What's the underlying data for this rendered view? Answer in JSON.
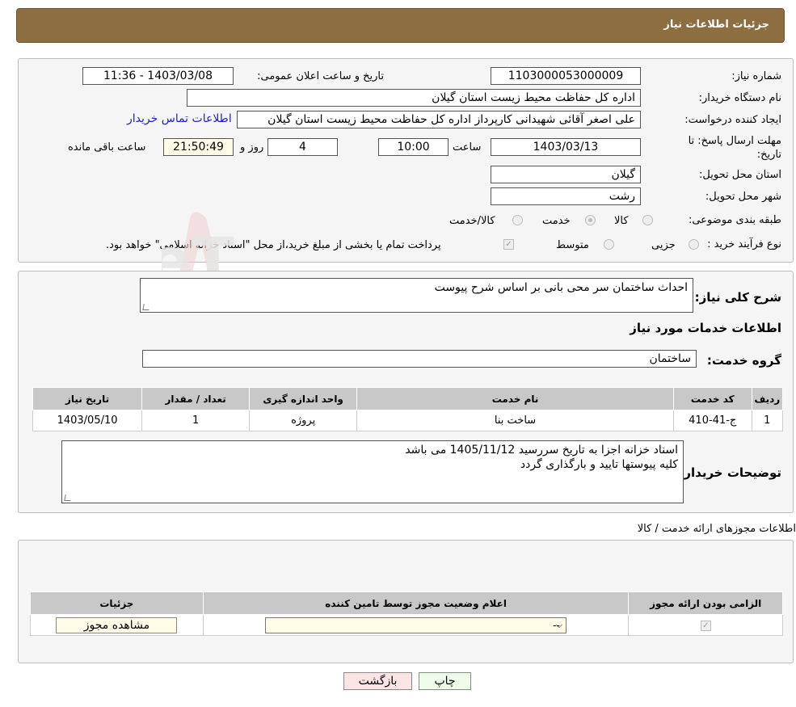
{
  "header": {
    "title": "جزئیات اطلاعات نیاز"
  },
  "form": {
    "need_number": {
      "label": "شماره نیاز:",
      "value": "1103000053000009"
    },
    "announce_datetime": {
      "label": "تاریخ و ساعت اعلان عمومی:",
      "value": "1403/03/08 - 11:36"
    },
    "buyer_org": {
      "label": "نام دستگاه خریدار:",
      "value": "اداره کل حفاظت محیط زیست استان گیلان"
    },
    "requester": {
      "label": "ایجاد کننده درخواست:",
      "value": "علی اصغر آقائی شهیدانی کارپرداز اداره کل حفاظت محیط زیست استان گیلان",
      "contact_link": "اطلاعات تماس خریدار"
    },
    "deadline": {
      "label": "مهلت ارسال پاسخ: تا تاریخ:",
      "date": "1403/03/13",
      "time_label": "ساعت",
      "time": "10:00",
      "days": "4",
      "days_label": "روز و",
      "remaining": "21:50:49",
      "remaining_label": "ساعت باقی مانده"
    },
    "delivery_province": {
      "label": "استان محل تحویل:",
      "value": "گیلان"
    },
    "delivery_city": {
      "label": "شهر محل تحویل:",
      "value": "رشت"
    },
    "category": {
      "label": "طبقه بندی موضوعی:",
      "options": [
        {
          "label": "کالا",
          "checked": false
        },
        {
          "label": "خدمت",
          "checked": true
        },
        {
          "label": "کالا/خدمت",
          "checked": false
        }
      ]
    },
    "purchase_process": {
      "label": "نوع فرآیند خرید :",
      "options": [
        {
          "label": "جزیی",
          "checked": false
        },
        {
          "label": "متوسط",
          "checked": false
        }
      ],
      "payment_checkbox_checked": true,
      "note": "پرداخت تمام یا بخشی از مبلغ خرید،از محل \"اسناد خزانه اسلامی\" خواهد بود."
    }
  },
  "details": {
    "summary_label": "شرح کلی نیاز:",
    "summary_value": "احداث  ساختمان سر محی بانی بر اساس شرح پیوست",
    "services_title": "اطلاعات خدمات مورد نیاز",
    "service_group_label": "گروه خدمت:",
    "service_group_value": "ساختمان",
    "table": {
      "headers": [
        "ردیف",
        "کد خدمت",
        "نام خدمت",
        "واحد اندازه گیری",
        "تعداد / مقدار",
        "تاریخ نیاز"
      ],
      "rows": [
        [
          "1",
          "ج-41-410",
          "ساخت بنا",
          "پروژه",
          "1",
          "1403/05/10"
        ]
      ]
    },
    "buyer_notes_label": "توضیحات خریدار:",
    "buyer_notes_lines": [
      "اسناد خزانه اجزا به تاریخ سررسید 1405/11/12 می باشد",
      "کلیه پیوستها تایید و بارگذاری گردد"
    ]
  },
  "permits": {
    "title": "اطلاعات مجوزهای ارائه خدمت / کالا",
    "headers": [
      "الزامی بودن ارائه مجوز",
      "اعلام وضعیت مجوز توسط تامین کننده",
      "جزئیات"
    ],
    "row": {
      "required_checked": true,
      "status_select": "--",
      "view_button": "مشاهده مجوز"
    }
  },
  "footer": {
    "print_button": "چاپ",
    "back_button": "بازگشت"
  },
  "watermark": {
    "text": "AriaTender.neT"
  },
  "colors": {
    "header_bg": "#8d6e41",
    "link": "#2020cc",
    "table_header_bg": "#c8c8c8"
  }
}
